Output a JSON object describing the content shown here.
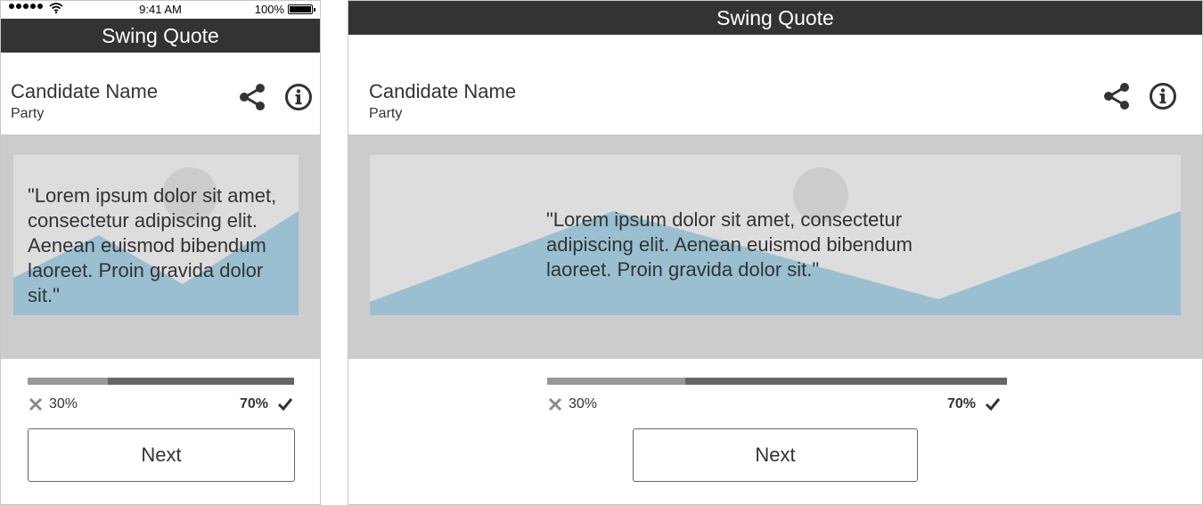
{
  "status_bar": {
    "time": "9:41 AM",
    "battery": "100%"
  },
  "app": {
    "title": "Swing Quote"
  },
  "candidate": {
    "name": "Candidate Name",
    "party": "Party"
  },
  "quote": {
    "text": "\"Lorem ipsum dolor sit amet, consectetur adipiscing elit. Aenean euismod bibendum laoreet. Proin gravida dolor sit.\""
  },
  "vote": {
    "no_label": "30%",
    "yes_label": "70%",
    "no_fraction": 0.3,
    "yes_fraction": 0.7
  },
  "buttons": {
    "next": "Next"
  },
  "icons": {
    "share": "share-icon",
    "info": "info-icon",
    "no": "x-icon",
    "yes": "check-icon"
  },
  "colors": {
    "titlebar": "#333333",
    "quote_bg": "#cccccc",
    "image_bg": "#dddddd",
    "mountain": "#99bfd1",
    "bar_track": "#666666",
    "bar_fill": "#999999"
  }
}
